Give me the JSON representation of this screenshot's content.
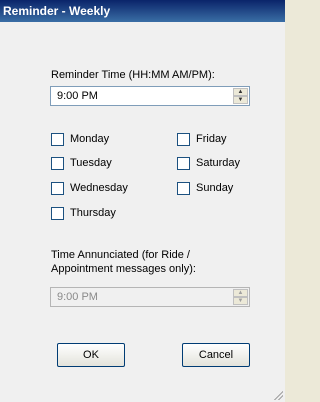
{
  "window": {
    "title": "Reminder - Weekly"
  },
  "reminder_time": {
    "label": "Reminder Time (HH:MM  AM/PM):",
    "value": "9:00 PM"
  },
  "days": {
    "monday": "Monday",
    "tuesday": "Tuesday",
    "wednesday": "Wednesday",
    "thursday": "Thursday",
    "friday": "Friday",
    "saturday": "Saturday",
    "sunday": "Sunday"
  },
  "announce": {
    "label_line1": "Time Annunciated (for Ride /",
    "label_line2": "Appointment messages only):",
    "value": "9:00 PM"
  },
  "buttons": {
    "ok": "OK",
    "cancel": "Cancel"
  },
  "icons": {
    "spin_up": "up-arrow-icon",
    "spin_down": "down-arrow-icon",
    "resize": "resize-grip-icon"
  }
}
